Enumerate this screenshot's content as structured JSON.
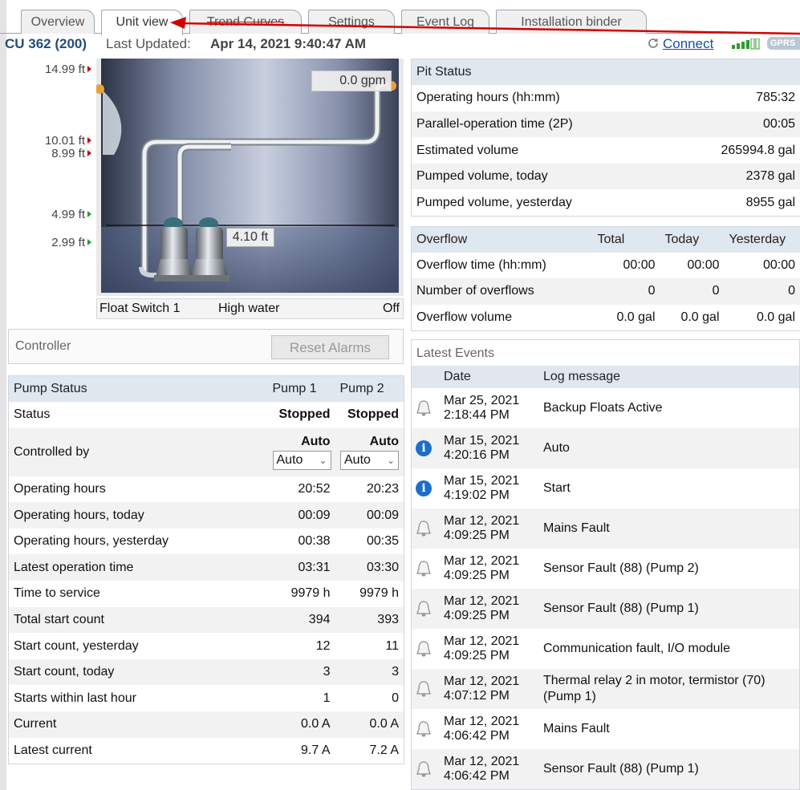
{
  "tabs": [
    {
      "label": "Overview"
    },
    {
      "label": "Unit view"
    },
    {
      "label": "Trend Curves"
    },
    {
      "label": "Settings"
    },
    {
      "label": "Event Log"
    },
    {
      "label": "Installation binder"
    }
  ],
  "header": {
    "unit": "CU 362 (200)",
    "last_updated_label": "Last Updated:",
    "last_updated_value": "Apr 14, 2021 9:40:47 AM",
    "connect": "Connect",
    "network": "GPRS"
  },
  "levels": [
    {
      "label": "14.99 ft",
      "color": "red"
    },
    {
      "label": "10.01 ft",
      "color": "red"
    },
    {
      "label": "8.99 ft",
      "color": "red"
    },
    {
      "label": "4.99 ft",
      "color": "green"
    },
    {
      "label": "2.99 ft",
      "color": "green"
    }
  ],
  "pit": {
    "flow": "0.0 gpm",
    "level": "4.10 ft",
    "float_switch": {
      "name": "Float Switch 1",
      "level": "High water",
      "state": "Off"
    }
  },
  "controller": {
    "label": "Controller",
    "reset_button": "Reset Alarms"
  },
  "pump_status": {
    "header": [
      "Pump Status",
      "Pump 1",
      "Pump 2"
    ],
    "status": {
      "label": "Status",
      "pump1": "Stopped",
      "pump2": "Stopped"
    },
    "controlled_by": {
      "label": "Controlled by",
      "pump1": "Auto",
      "pump2": "Auto",
      "select1": "Auto",
      "select2": "Auto"
    },
    "rows": [
      {
        "label": "Operating hours",
        "pump1": "20:52",
        "pump2": "20:23"
      },
      {
        "label": "Operating hours, today",
        "pump1": "00:09",
        "pump2": "00:09"
      },
      {
        "label": "Operating hours, yesterday",
        "pump1": "00:38",
        "pump2": "00:35"
      },
      {
        "label": "Latest operation time",
        "pump1": "03:31",
        "pump2": "03:30"
      },
      {
        "label": "Time to service",
        "pump1": "9979 h",
        "pump2": "9979 h"
      },
      {
        "label": "Total start count",
        "pump1": "394",
        "pump2": "393"
      },
      {
        "label": "Start count, yesterday",
        "pump1": "12",
        "pump2": "11"
      },
      {
        "label": "Start count, today",
        "pump1": "3",
        "pump2": "3"
      },
      {
        "label": "Starts within last hour",
        "pump1": "1",
        "pump2": "0"
      },
      {
        "label": "Current",
        "pump1": "0.0 A",
        "pump2": "0.0 A"
      },
      {
        "label": "Latest current",
        "pump1": "9.7 A",
        "pump2": "7.2 A"
      }
    ]
  },
  "pit_status": {
    "title": "Pit Status",
    "rows": [
      {
        "label": "Operating hours (hh:mm)",
        "value": "785:32"
      },
      {
        "label": "Parallel-operation time (2P)",
        "value": "00:05"
      },
      {
        "label": "Estimated volume",
        "value": "265994.8 gal"
      },
      {
        "label": "Pumped volume, today",
        "value": "2378 gal"
      },
      {
        "label": "Pumped volume, yesterday",
        "value": "8955 gal"
      }
    ]
  },
  "overflow": {
    "header": [
      "Overflow",
      "Total",
      "Today",
      "Yesterday"
    ],
    "rows": [
      {
        "label": "Overflow time (hh:mm)",
        "total": "00:00",
        "today": "00:00",
        "yesterday": "00:00"
      },
      {
        "label": "Number of overflows",
        "total": "0",
        "today": "0",
        "yesterday": "0"
      },
      {
        "label": "Overflow volume",
        "total": "0.0 gal",
        "today": "0.0 gal",
        "yesterday": "0.0 gal"
      }
    ]
  },
  "events": {
    "title": "Latest Events",
    "columns": [
      "Date",
      "Log message"
    ],
    "rows": [
      {
        "icon": "bell-icon",
        "date": "Mar 25, 2021",
        "time": "2:18:44 PM",
        "message": "Backup Floats Active"
      },
      {
        "icon": "info-icon",
        "date": "Mar 15, 2021",
        "time": "4:20:16 PM",
        "message": "Auto"
      },
      {
        "icon": "info-icon",
        "date": "Mar 15, 2021",
        "time": "4:19:02 PM",
        "message": "Start"
      },
      {
        "icon": "bell-icon",
        "date": "Mar 12, 2021",
        "time": "4:09:25 PM",
        "message": "Mains Fault"
      },
      {
        "icon": "bell-icon",
        "date": "Mar 12, 2021",
        "time": "4:09:25 PM",
        "message": "Sensor Fault (88) (Pump 2)"
      },
      {
        "icon": "bell-icon",
        "date": "Mar 12, 2021",
        "time": "4:09:25 PM",
        "message": "Sensor Fault (88) (Pump 1)"
      },
      {
        "icon": "bell-icon",
        "date": "Mar 12, 2021",
        "time": "4:09:25 PM",
        "message": "Communication fault, I/O module"
      },
      {
        "icon": "bell-icon",
        "date": "Mar 12, 2021",
        "time": "4:07:12 PM",
        "message": "Thermal relay 2 in motor, termistor (70) (Pump 1)"
      },
      {
        "icon": "bell-icon",
        "date": "Mar 12, 2021",
        "time": "4:06:42 PM",
        "message": "Mains Fault"
      },
      {
        "icon": "bell-icon",
        "date": "Mar 12, 2021",
        "time": "4:06:42 PM",
        "message": "Sensor Fault (88) (Pump 1)"
      }
    ]
  },
  "colors": {
    "title_blue": "#224d7a",
    "link_blue": "#1a4f9c",
    "alarm_red": "#cc0000",
    "ok_green": "#2a9d2a",
    "header_bg": "#dfe7ef"
  }
}
